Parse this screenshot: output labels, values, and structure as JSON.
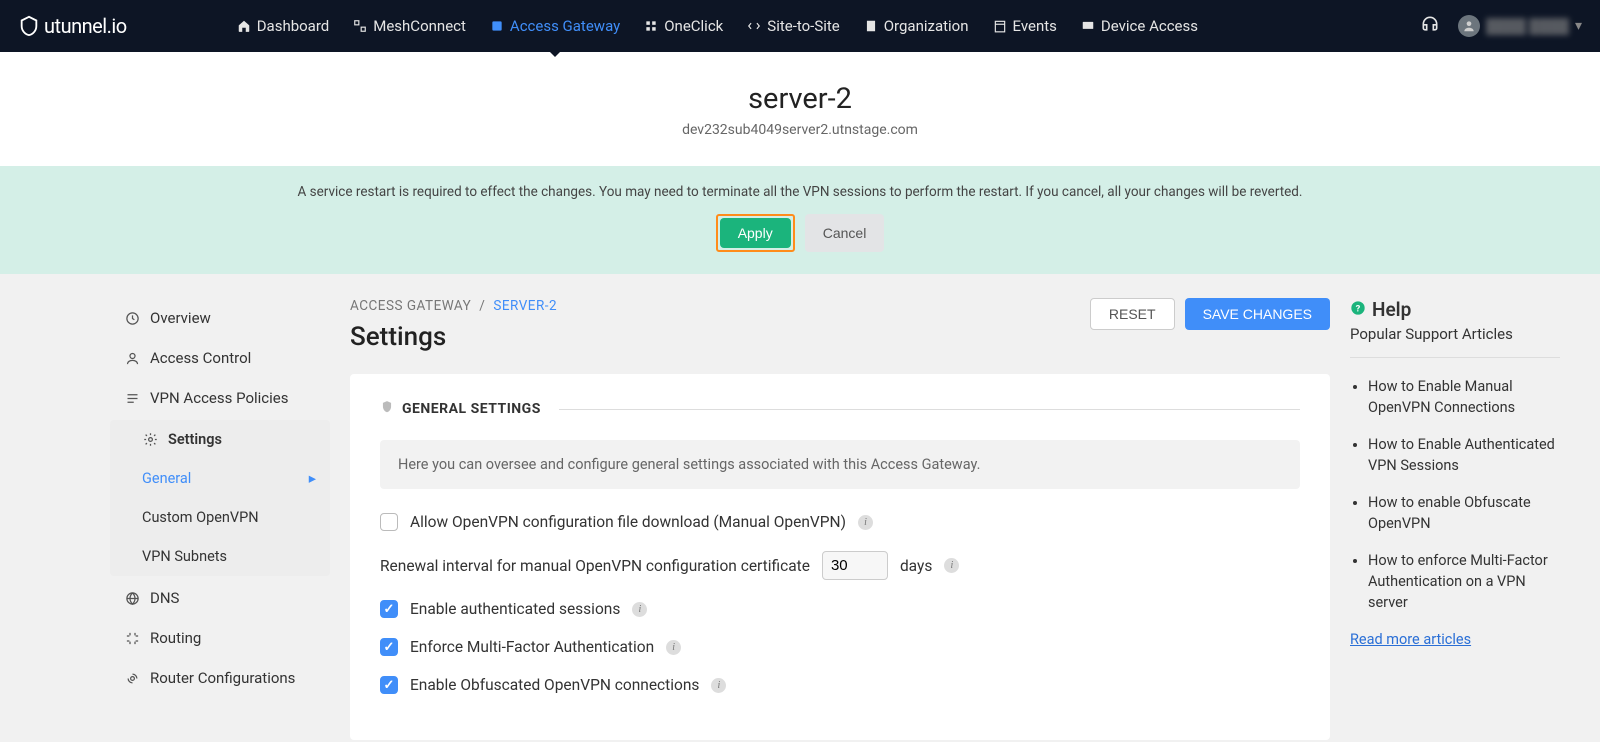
{
  "brand": "utunnel.io",
  "nav": [
    "Dashboard",
    "MeshConnect",
    "Access Gateway",
    "OneClick",
    "Site-to-Site",
    "Organization",
    "Events",
    "Device Access"
  ],
  "server": {
    "title": "server-2",
    "host": "dev232sub4049server2.utnstage.com"
  },
  "notice": {
    "text": "A service restart is required to effect the changes. You may need to terminate all the VPN sessions to perform the restart. If you cancel, all your changes will be reverted.",
    "apply": "Apply",
    "cancel": "Cancel"
  },
  "breadcrumb": {
    "a": "ACCESS GATEWAY",
    "sep": "/",
    "b": "SERVER-2"
  },
  "pageTitle": "Settings",
  "buttons": {
    "reset": "RESET",
    "save": "SAVE CHANGES"
  },
  "sidebar": {
    "items": [
      "Overview",
      "Access Control",
      "VPN Access Policies",
      "Settings",
      "DNS",
      "Routing",
      "Router Configurations"
    ],
    "sub": [
      "General",
      "Custom OpenVPN",
      "VPN Subnets"
    ]
  },
  "section": {
    "title": "GENERAL SETTINGS",
    "desc": "Here you can oversee and configure general settings associated with this Access Gateway."
  },
  "settings": {
    "allowDownload": "Allow OpenVPN configuration file download (Manual OpenVPN)",
    "renewalLabelA": "Renewal interval for manual OpenVPN configuration certificate",
    "renewalValue": "30",
    "renewalLabelB": "days",
    "authSessions": "Enable authenticated sessions",
    "mfa": "Enforce Multi-Factor Authentication",
    "obfuscated": "Enable Obfuscated OpenVPN connections"
  },
  "help": {
    "title": "Help",
    "subtitle": "Popular Support Articles",
    "articles": [
      "How to Enable Manual OpenVPN Connections",
      "How to Enable Authenticated VPN Sessions",
      "How to enable Obfuscate OpenVPN",
      "How to enforce Multi-Factor Authentication on a VPN server"
    ],
    "more": "Read more articles"
  }
}
